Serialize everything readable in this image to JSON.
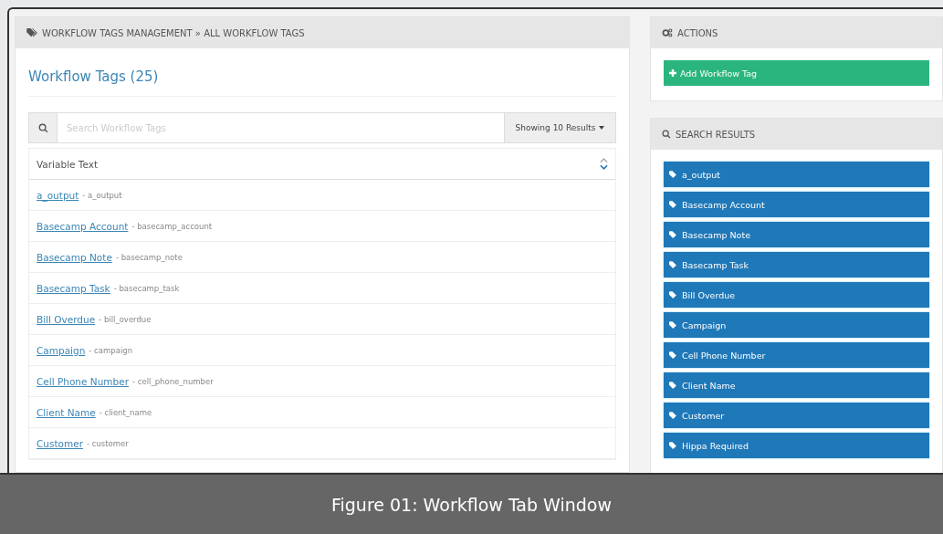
{
  "breadcrumb": "WORKFLOW TAGS MANAGEMENT » ALL WORKFLOW TAGS",
  "title": "Workflow Tags (25)",
  "search": {
    "placeholder": "Search Workflow Tags",
    "results_menu": "Showing 10 Results"
  },
  "table": {
    "column": "Variable Text",
    "rows": [
      {
        "name": "a_output",
        "key": "- a_output"
      },
      {
        "name": "Basecamp Account",
        "key": "- basecamp_account"
      },
      {
        "name": "Basecamp Note",
        "key": "- basecamp_note"
      },
      {
        "name": "Basecamp Task",
        "key": "- basecamp_task"
      },
      {
        "name": "Bill Overdue",
        "key": "- bill_overdue"
      },
      {
        "name": "Campaign",
        "key": "- campaign"
      },
      {
        "name": "Cell Phone Number",
        "key": "- cell_phone_number"
      },
      {
        "name": "Client Name",
        "key": "- client_name"
      },
      {
        "name": "Customer",
        "key": "- customer"
      }
    ]
  },
  "actions": {
    "heading": "ACTIONS",
    "button": "Add Workflow Tag"
  },
  "search_results": {
    "heading": "SEARCH RESULTS",
    "items": [
      "a_output",
      "Basecamp Account",
      "Basecamp Note",
      "Basecamp Task",
      "Bill Overdue",
      "Campaign",
      "Cell Phone Number",
      "Client Name",
      "Customer",
      "Hippa Required"
    ]
  },
  "caption": "Figure 01: Workflow Tab Window"
}
